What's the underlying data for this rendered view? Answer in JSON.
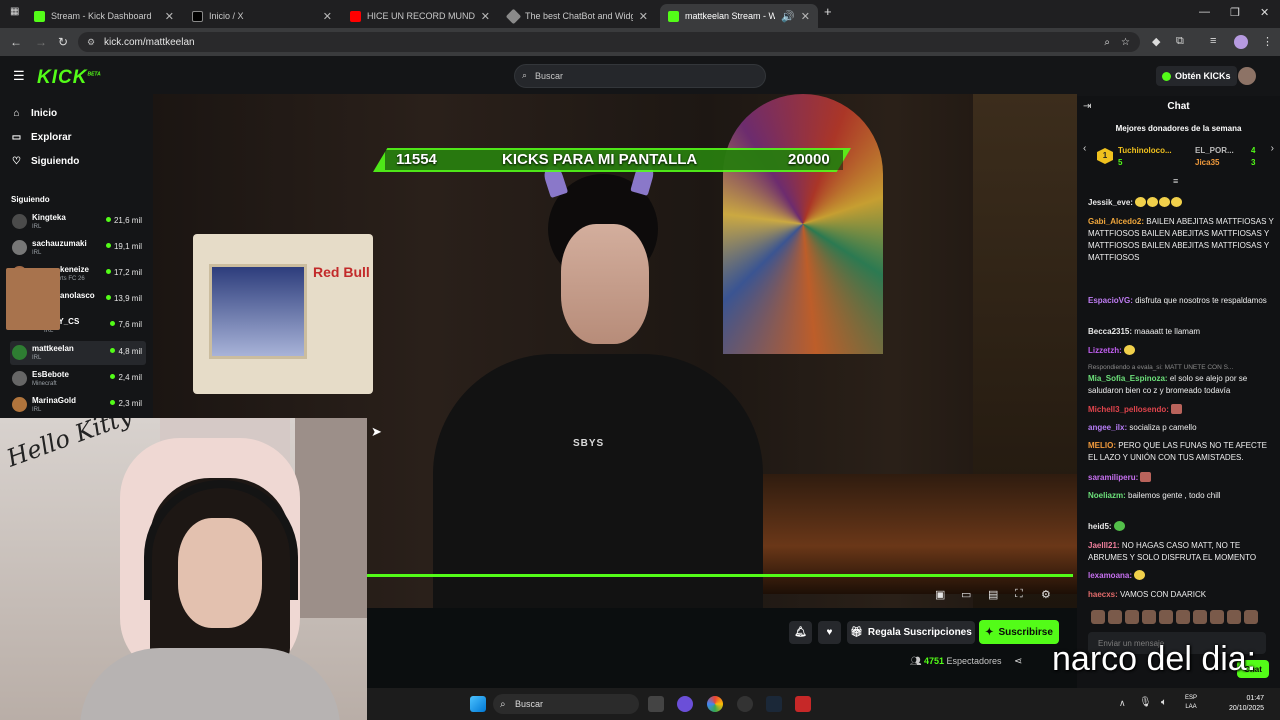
{
  "browser": {
    "tabs": [
      {
        "label": "Stream - Kick Dashboard",
        "color": "#53fc18"
      },
      {
        "label": "Inicio / X",
        "color": "#000000"
      },
      {
        "label": "HICE UN RECORD MUNDIAL EN",
        "color": "#ff0000"
      },
      {
        "label": "The best ChatBot and Widgets",
        "color": "#8a8a8a"
      },
      {
        "label": "mattkeelan Stream - Watch",
        "color": "#53fc18"
      }
    ],
    "url": "kick.com/mattkeelan"
  },
  "kick": {
    "logo": "KICK",
    "logo_sup": "BETA",
    "search_placeholder": "Buscar",
    "get_kicks": "Obtén KICKs",
    "accent": "#53fc18"
  },
  "sidebar": {
    "nav": [
      {
        "label": "Inicio",
        "icon": "home-icon"
      },
      {
        "label": "Explorar",
        "icon": "compass-icon"
      },
      {
        "label": "Siguiendo",
        "icon": "heart-icon"
      }
    ],
    "following_heading": "Siguiendo",
    "channels": [
      {
        "name": "Kingteka",
        "cat": "IRL",
        "viewers": "21,6 mil"
      },
      {
        "name": "sachauzumaki",
        "cat": "IRL",
        "viewers": "19,1 mil"
      },
      {
        "name": "keneize",
        "cat": "rts FC 26",
        "viewers": "17,2 mil"
      },
      {
        "name": "anolasco",
        "cat": "",
        "viewers": "13,9 mil"
      },
      {
        "name": "LLYY_CS",
        "cat": "IRL",
        "viewers": "7,6 mil"
      },
      {
        "name": "mattkeelan",
        "cat": "IRL",
        "viewers": "4,8 mil"
      },
      {
        "name": "EsBebote",
        "cat": "Minecraft",
        "viewers": "2,4 mil"
      },
      {
        "name": "MarinaGold",
        "cat": "IRL",
        "viewers": "2,3 mil"
      }
    ]
  },
  "stream": {
    "kick_goal_left": "11554",
    "kick_goal_title": "KICKS PARA MI PANTALLA",
    "kick_goal_right": "20000",
    "hoodie_text": "SBYS",
    "wall_sign": "Red Bull",
    "facecam_text": "Hello Kitty"
  },
  "actions": {
    "subs_gift": "Regala Suscripciones",
    "subscribe": "Suscribirse",
    "viewers_count": "4751",
    "viewers_label": "Espectadores"
  },
  "chat": {
    "title": "Chat",
    "top_donors_heading": "Mejores donadores de la semana",
    "donors": [
      {
        "rank": "1",
        "name": "Tuchinoloco...",
        "count": "5"
      },
      {
        "name": "EL_POR...",
        "count": "4"
      },
      {
        "name": "Jica35",
        "count": "3"
      }
    ],
    "messages": [
      {
        "user": "Jessik_eve:",
        "color": "#e7e7e7",
        "text": ""
      },
      {
        "user": "Gabi_Alcedo2:",
        "color": "#f0a73c",
        "text": "BAILEN ABEJITAS MATTFIOSAS Y MATTFIOSOS BAILEN ABEJITAS MATTFIOSAS Y MATTFIOSOS BAILEN ABEJITAS MATTFIOSAS Y MATTFIOSOS"
      },
      {
        "user": "EspacioVG:",
        "color": "#bf7cf3",
        "text": "disfruta que nosotros te respaldamos"
      },
      {
        "user": "Becca2315:",
        "color": "#e7e7e7",
        "text": "maaaatt te llamam"
      },
      {
        "user": "Lizzetzh:",
        "color": "#c15ff0",
        "text": ""
      },
      {
        "user": "Respondiendo a evala_si: MATT UNETE CON S...",
        "color": "#8a8a8a",
        "text": ""
      },
      {
        "user": "Mia_Sofia_Espinoza:",
        "color": "#6ce07a",
        "text": "el solo se alejo por se saludaron bien co z y bromeado todavía"
      },
      {
        "user": "Michell3_pellosendo:",
        "color": "#e0444c",
        "text": ""
      },
      {
        "user": "angee_ilx:",
        "color": "#b67cf5",
        "text": "socializa p camello"
      },
      {
        "user": "MELIO:",
        "color": "#f19a3c",
        "text": "PERO QUE LAS FUNAS NO TE AFECTE EL LAZO Y UNIÓN CON TUS AMISTADES."
      },
      {
        "user": "saramiliperu:",
        "color": "#c770f0",
        "text": ""
      },
      {
        "user": "Noeliazm:",
        "color": "#6ce07a",
        "text": "bailemos gente , todo chill"
      },
      {
        "user": "heid5:",
        "color": "#e7e7e7",
        "text": ""
      },
      {
        "user": "Jaelll21:",
        "color": "#f07f9c",
        "text": "NO HAGAS CASO MATT, NO TE ABRUMES Y SOLO DISFRUTA EL MOMENTO"
      },
      {
        "user": "lexamoana:",
        "color": "#c770f0",
        "text": ""
      },
      {
        "user": "haecxs:",
        "color": "#e26b6b",
        "text": "VAMOS CON DAARICK"
      }
    ],
    "input_placeholder": "Enviar un mensaje",
    "send_label": "Chat"
  },
  "taskbar": {
    "search": "Buscar",
    "lang_top": "ESP",
    "lang_bottom": "LAA",
    "time": "01:47",
    "date": "20/10/2025"
  },
  "overlay_caption": "narco del dia:"
}
